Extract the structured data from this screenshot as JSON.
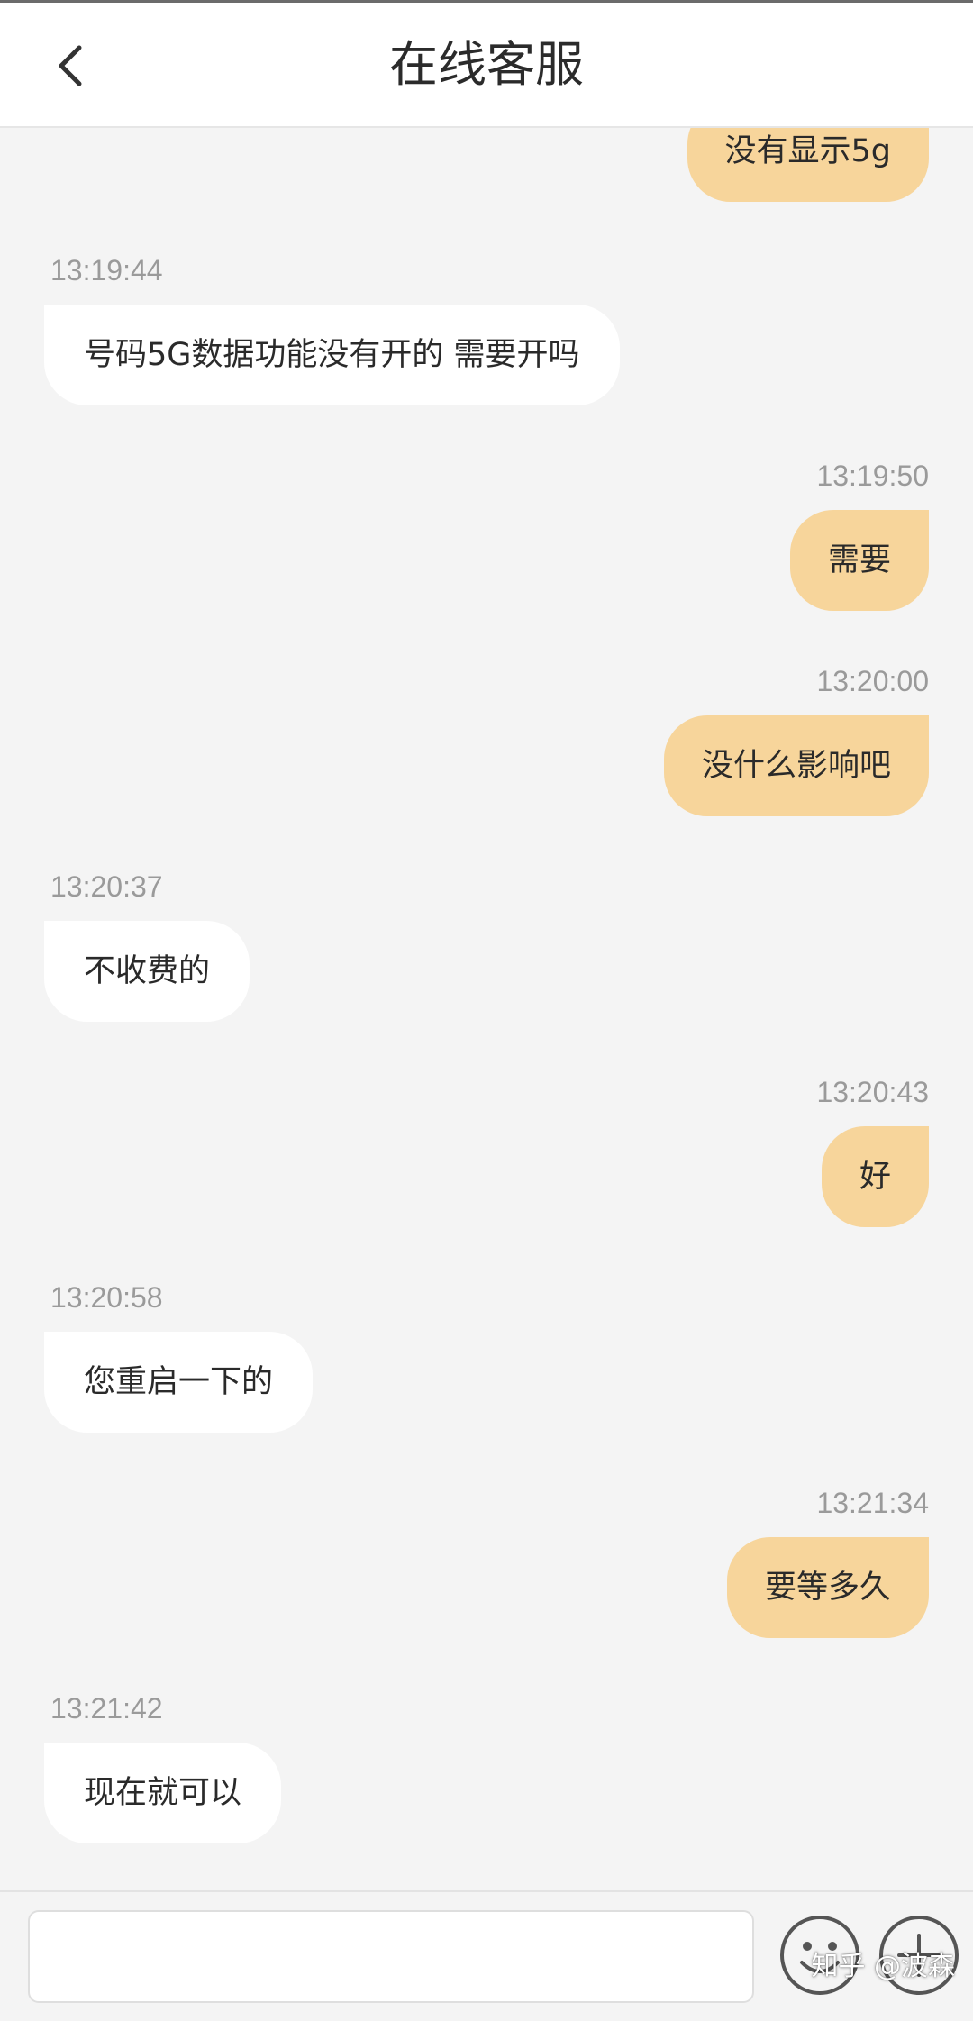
{
  "header": {
    "title": "在线客服",
    "back_icon": "chevron-left-icon"
  },
  "messages": [
    {
      "sender": "user",
      "time": "",
      "text": "没有显示5g"
    },
    {
      "sender": "agent",
      "time": "13:19:44",
      "text": "号码5G数据功能没有开的 需要开吗"
    },
    {
      "sender": "user",
      "time": "13:19:50",
      "text": "需要"
    },
    {
      "sender": "user",
      "time": "13:20:00",
      "text": "没什么影响吧"
    },
    {
      "sender": "agent",
      "time": "13:20:37",
      "text": "不收费的"
    },
    {
      "sender": "user",
      "time": "13:20:43",
      "text": "好"
    },
    {
      "sender": "agent",
      "time": "13:20:58",
      "text": "您重启一下的"
    },
    {
      "sender": "user",
      "time": "13:21:34",
      "text": "要等多久"
    },
    {
      "sender": "agent",
      "time": "13:21:42",
      "text": "现在就可以"
    }
  ],
  "composer": {
    "input_value": "",
    "emoji_icon": "emoji-icon",
    "plus_icon": "plus-icon"
  },
  "watermark": "知乎 @波森",
  "colors": {
    "user_bubble": "#f7d59b",
    "agent_bubble": "#ffffff",
    "background": "#f4f4f4",
    "timestamp": "#9a9a9a"
  }
}
